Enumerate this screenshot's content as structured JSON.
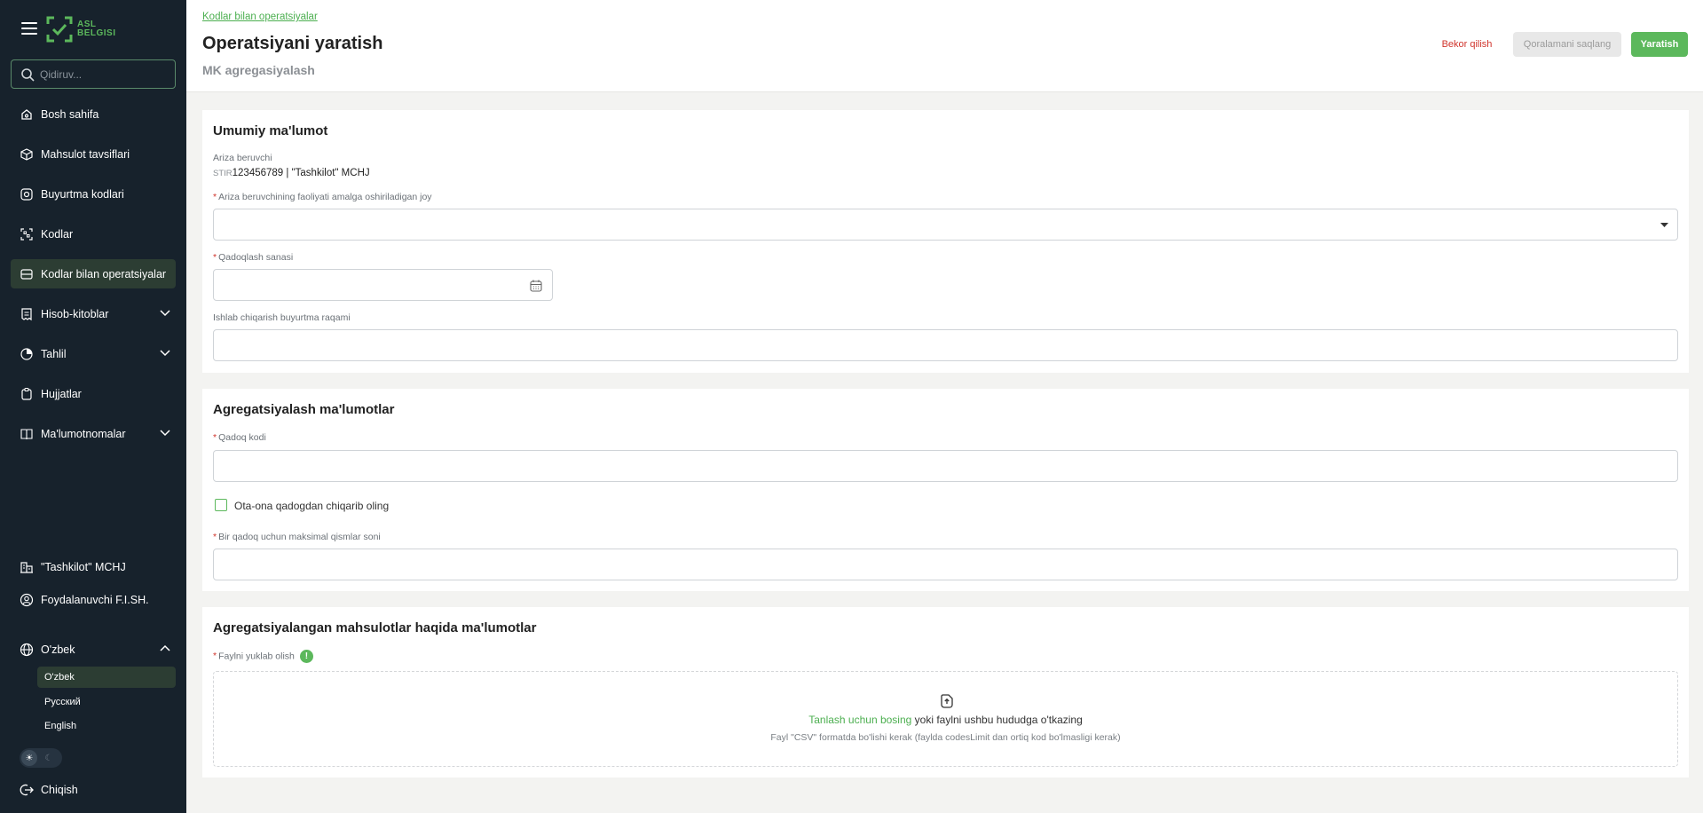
{
  "brand": {
    "logo_line1": "ASL",
    "logo_line2": "BELGISI",
    "accent": "#5cb85c"
  },
  "search": {
    "placeholder": "Qidiruv..."
  },
  "sidebar": {
    "items": [
      {
        "label": "Bosh sahifa",
        "icon": "home-icon"
      },
      {
        "label": "Mahsulot tavsiflari",
        "icon": "box-icon"
      },
      {
        "label": "Buyurtma kodlari",
        "icon": "order-codes-icon"
      },
      {
        "label": "Kodlar",
        "icon": "scan-icon"
      },
      {
        "label": "Kodlar bilan operatsiyalar",
        "icon": "operations-icon",
        "active": true
      },
      {
        "label": "Hisob-kitoblar",
        "icon": "receipt-icon",
        "expandable": true
      },
      {
        "label": "Tahlil",
        "icon": "analytics-icon",
        "expandable": true
      },
      {
        "label": "Hujjatlar",
        "icon": "clipboard-icon"
      },
      {
        "label": "Ma'lumotnomalar",
        "icon": "book-icon",
        "expandable": true
      }
    ],
    "org": "\"Tashkilot\" MCHJ",
    "user": "Foydalanuvchi F.I.SH.",
    "language": {
      "current": "O'zbek",
      "options": [
        "O'zbek",
        "Русский",
        "English"
      ]
    },
    "logout": "Chiqish"
  },
  "header": {
    "breadcrumb": "Kodlar bilan operatsiyalar",
    "title": "Operatsiyani yaratish",
    "subtitle": "MK agregasiyalash",
    "cancel_label": "Bekor qilish",
    "draft_label": "Qoralamani saqlang",
    "create_label": "Yaratish"
  },
  "general": {
    "title": "Umumiy ma'lumot",
    "applicant_label": "Ariza beruvchi",
    "stir_prefix": "STIR",
    "stir_value": "123456789 | \"Tashkilot\" MCHJ",
    "location_label": "Ariza beruvchining faoliyati amalga oshiriladigan joy",
    "location_value": "",
    "packing_date_label": "Qadoqlash sanasi",
    "packing_date_value": "",
    "order_number_label": "Ishlab chiqarish buyurtma raqami",
    "order_number_value": ""
  },
  "aggregation": {
    "title": "Agregatsiyalash ma'lumotlar",
    "package_code_label": "Qadoq kodi",
    "package_code_value": "",
    "remove_parent_label": "Ota-ona qadogdan chiqarib oling",
    "remove_parent_checked": false,
    "max_parts_label": "Bir qadoq uchun maksimal qismlar soni",
    "max_parts_value": ""
  },
  "aggregated_products": {
    "title": "Agregatsiyalangan mahsulotlar haqida ma'lumotlar",
    "file_label": "Faylni yuklab olish",
    "info_icon": "!",
    "upload_link": "Tanlash uchun bosing",
    "upload_text": " yoki faylni ushbu hududga o'tkazing",
    "upload_hint": "Fayl \"CSV\" formatda bo'lishi kerak (faylda codesLimit dan ortiq kod bo'lmasligi kerak)"
  }
}
